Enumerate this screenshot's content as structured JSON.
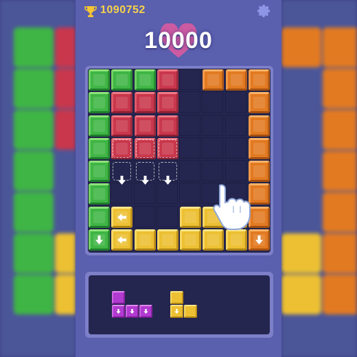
{
  "header": {
    "best_score": "1090752",
    "score": "10000",
    "trophy_icon": "trophy-icon",
    "settings_icon": "gear-icon"
  },
  "colors": {
    "green": "#3fb545",
    "red": "#c9374c",
    "orange": "#e27a22",
    "yellow": "#ecc032",
    "purple": "#b13ad0",
    "board_bg": "#24264f",
    "frame": "#5a5fae"
  },
  "board": {
    "size": 8,
    "cells": [
      [
        "green",
        "green",
        "green",
        "red",
        null,
        "orange",
        "orange",
        "orange"
      ],
      [
        "green",
        "red",
        "red",
        "red",
        null,
        null,
        null,
        "orange"
      ],
      [
        "green",
        "red",
        "red",
        "red",
        null,
        null,
        null,
        "orange"
      ],
      [
        "green",
        "red",
        "red",
        "red",
        null,
        null,
        null,
        "orange"
      ],
      [
        "green",
        null,
        null,
        null,
        null,
        null,
        null,
        "orange"
      ],
      [
        "green",
        null,
        null,
        null,
        null,
        null,
        null,
        "orange"
      ],
      [
        "green",
        "yellow",
        null,
        null,
        "yellow",
        "yellow",
        "yellow",
        "orange"
      ],
      [
        "green",
        "yellow",
        "yellow",
        "yellow",
        "yellow",
        "yellow",
        "yellow",
        "orange"
      ]
    ],
    "arrows": [
      {
        "row": 7,
        "col": 0,
        "dir": "down"
      },
      {
        "row": 6,
        "col": 1,
        "dir": "left"
      },
      {
        "row": 7,
        "col": 1,
        "dir": "left"
      },
      {
        "row": 7,
        "col": 7,
        "dir": "down"
      }
    ],
    "drop_hints": [
      {
        "row": 4,
        "col": 1,
        "dir": "down"
      },
      {
        "row": 4,
        "col": 2,
        "dir": "down"
      },
      {
        "row": 4,
        "col": 3,
        "dir": "down"
      }
    ],
    "ghost_rows": [
      3,
      4
    ],
    "ghost_cols": [
      1,
      2,
      3
    ]
  },
  "tray": {
    "pieces": [
      {
        "name": "purple-l-piece",
        "color": "purple",
        "cells": [
          [
            0,
            0
          ],
          [
            1,
            0
          ],
          [
            1,
            1
          ],
          [
            1,
            2
          ]
        ],
        "arrows": [
          [
            1,
            0
          ],
          [
            1,
            1
          ],
          [
            1,
            2
          ]
        ]
      },
      {
        "name": "yellow-l-piece",
        "color": "yellow",
        "cells": [
          [
            0,
            0
          ],
          [
            1,
            0
          ],
          [
            1,
            1
          ]
        ],
        "arrows": [
          [
            1,
            0
          ]
        ]
      }
    ]
  }
}
